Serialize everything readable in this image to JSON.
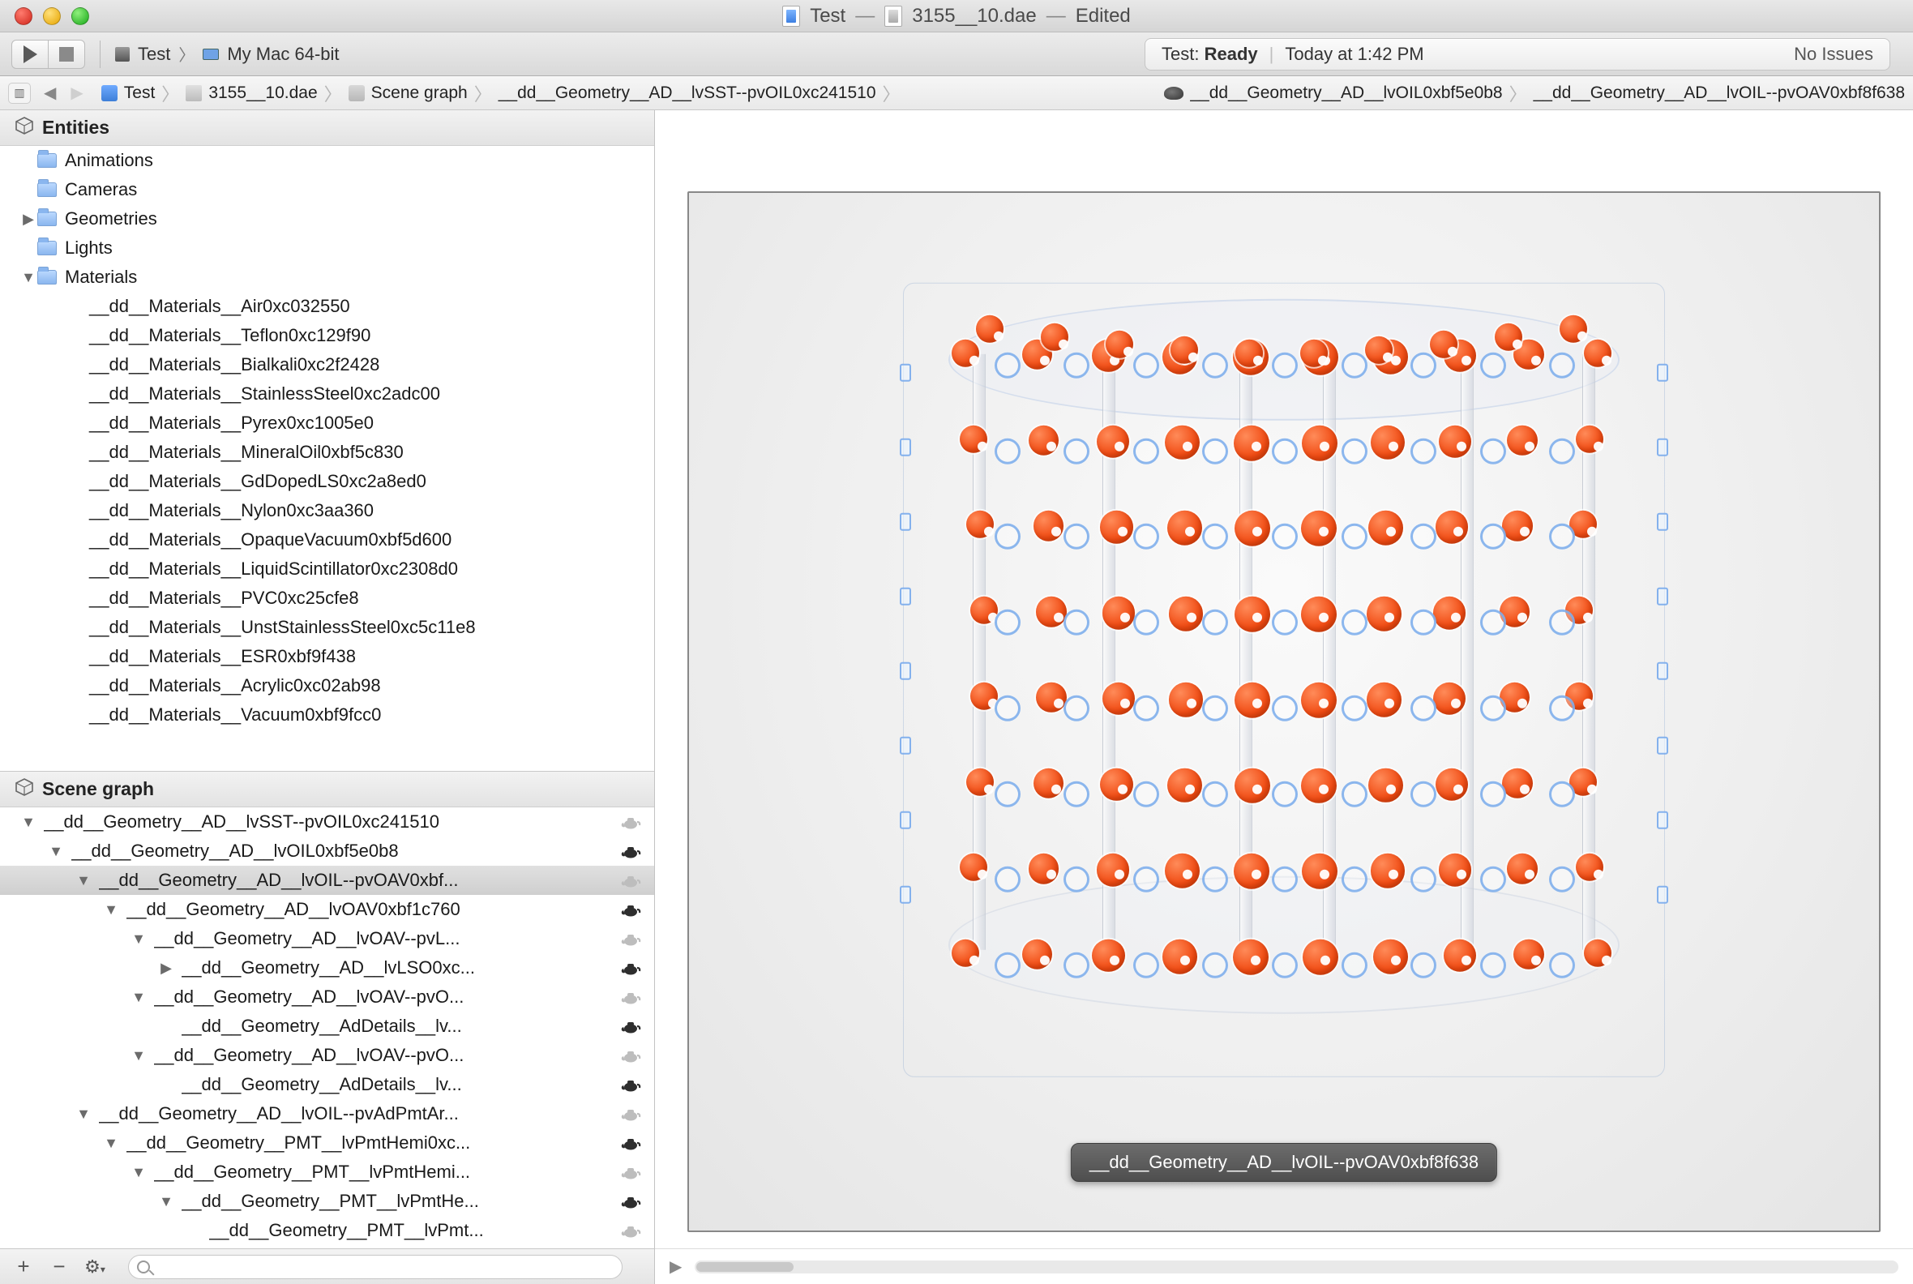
{
  "window": {
    "title_left": "Test",
    "title_right": "3155__10.dae",
    "edited": "Edited"
  },
  "toolbar": {
    "scheme_name": "Test",
    "device": "My Mac 64-bit"
  },
  "status": {
    "prefix": "Test:",
    "state": "Ready",
    "time": "Today at 1:42 PM",
    "issues": "No Issues"
  },
  "jumpbar": {
    "items": [
      "Test",
      "3155__10.dae",
      "Scene graph",
      "__dd__Geometry__AD__lvSST--pvOIL0xc241510",
      "__dd__Geometry__AD__lvOIL0xbf5e0b8",
      "__dd__Geometry__AD__lvOIL--pvOAV0xbf8f638"
    ]
  },
  "entities": {
    "header": "Entities",
    "items": [
      {
        "label": "Animations",
        "disclosure": "",
        "folder": true
      },
      {
        "label": "Cameras",
        "disclosure": "",
        "folder": true
      },
      {
        "label": "Geometries",
        "disclosure": "right",
        "folder": true
      },
      {
        "label": "Lights",
        "disclosure": "",
        "folder": true
      },
      {
        "label": "Materials",
        "disclosure": "down",
        "folder": true
      }
    ],
    "materials": [
      "__dd__Materials__Air0xc032550",
      "__dd__Materials__Teflon0xc129f90",
      "__dd__Materials__Bialkali0xc2f2428",
      "__dd__Materials__StainlessSteel0xc2adc00",
      "__dd__Materials__Pyrex0xc1005e0",
      "__dd__Materials__MineralOil0xbf5c830",
      "__dd__Materials__GdDopedLS0xc2a8ed0",
      "__dd__Materials__Nylon0xc3aa360",
      "__dd__Materials__OpaqueVacuum0xbf5d600",
      "__dd__Materials__LiquidScintillator0xc2308d0",
      "__dd__Materials__PVC0xc25cfe8",
      "__dd__Materials__UnstStainlessSteel0xc5c11e8",
      "__dd__Materials__ESR0xbf9f438",
      "__dd__Materials__Acrylic0xc02ab98",
      "__dd__Materials__Vacuum0xbf9fcc0"
    ]
  },
  "scene": {
    "header": "Scene graph",
    "rows": [
      {
        "indent": 0,
        "disc": "down",
        "label": "__dd__Geometry__AD__lvSST--pvOIL0xc241510",
        "teapot": "light"
      },
      {
        "indent": 1,
        "disc": "down",
        "label": "__dd__Geometry__AD__lvOIL0xbf5e0b8",
        "teapot": "dark"
      },
      {
        "indent": 2,
        "disc": "down",
        "label": "__dd__Geometry__AD__lvOIL--pvOAV0xbf...",
        "teapot": "light",
        "selected": true
      },
      {
        "indent": 3,
        "disc": "down",
        "label": "__dd__Geometry__AD__lvOAV0xbf1c760",
        "teapot": "dark"
      },
      {
        "indent": 4,
        "disc": "down",
        "label": "__dd__Geometry__AD__lvOAV--pvL...",
        "teapot": "light"
      },
      {
        "indent": 5,
        "disc": "right",
        "label": "__dd__Geometry__AD__lvLSO0xc...",
        "teapot": "dark"
      },
      {
        "indent": 4,
        "disc": "down",
        "label": "__dd__Geometry__AD__lvOAV--pvO...",
        "teapot": "light"
      },
      {
        "indent": 5,
        "disc": "",
        "label": "__dd__Geometry__AdDetails__lv...",
        "teapot": "dark"
      },
      {
        "indent": 4,
        "disc": "down",
        "label": "__dd__Geometry__AD__lvOAV--pvO...",
        "teapot": "light"
      },
      {
        "indent": 5,
        "disc": "",
        "label": "__dd__Geometry__AdDetails__lv...",
        "teapot": "dark"
      },
      {
        "indent": 2,
        "disc": "down",
        "label": "__dd__Geometry__AD__lvOIL--pvAdPmtAr...",
        "teapot": "light"
      },
      {
        "indent": 3,
        "disc": "down",
        "label": "__dd__Geometry__PMT__lvPmtHemi0xc...",
        "teapot": "dark"
      },
      {
        "indent": 4,
        "disc": "down",
        "label": "__dd__Geometry__PMT__lvPmtHemi...",
        "teapot": "light"
      },
      {
        "indent": 5,
        "disc": "down",
        "label": "__dd__Geometry__PMT__lvPmtHe...",
        "teapot": "dark"
      },
      {
        "indent": 6,
        "disc": "",
        "label": "__dd__Geometry__PMT__lvPmt...",
        "teapot": "light"
      }
    ]
  },
  "viewport": {
    "selection_label": "__dd__Geometry__AD__lvOIL--pvOAV0xbf8f638"
  }
}
